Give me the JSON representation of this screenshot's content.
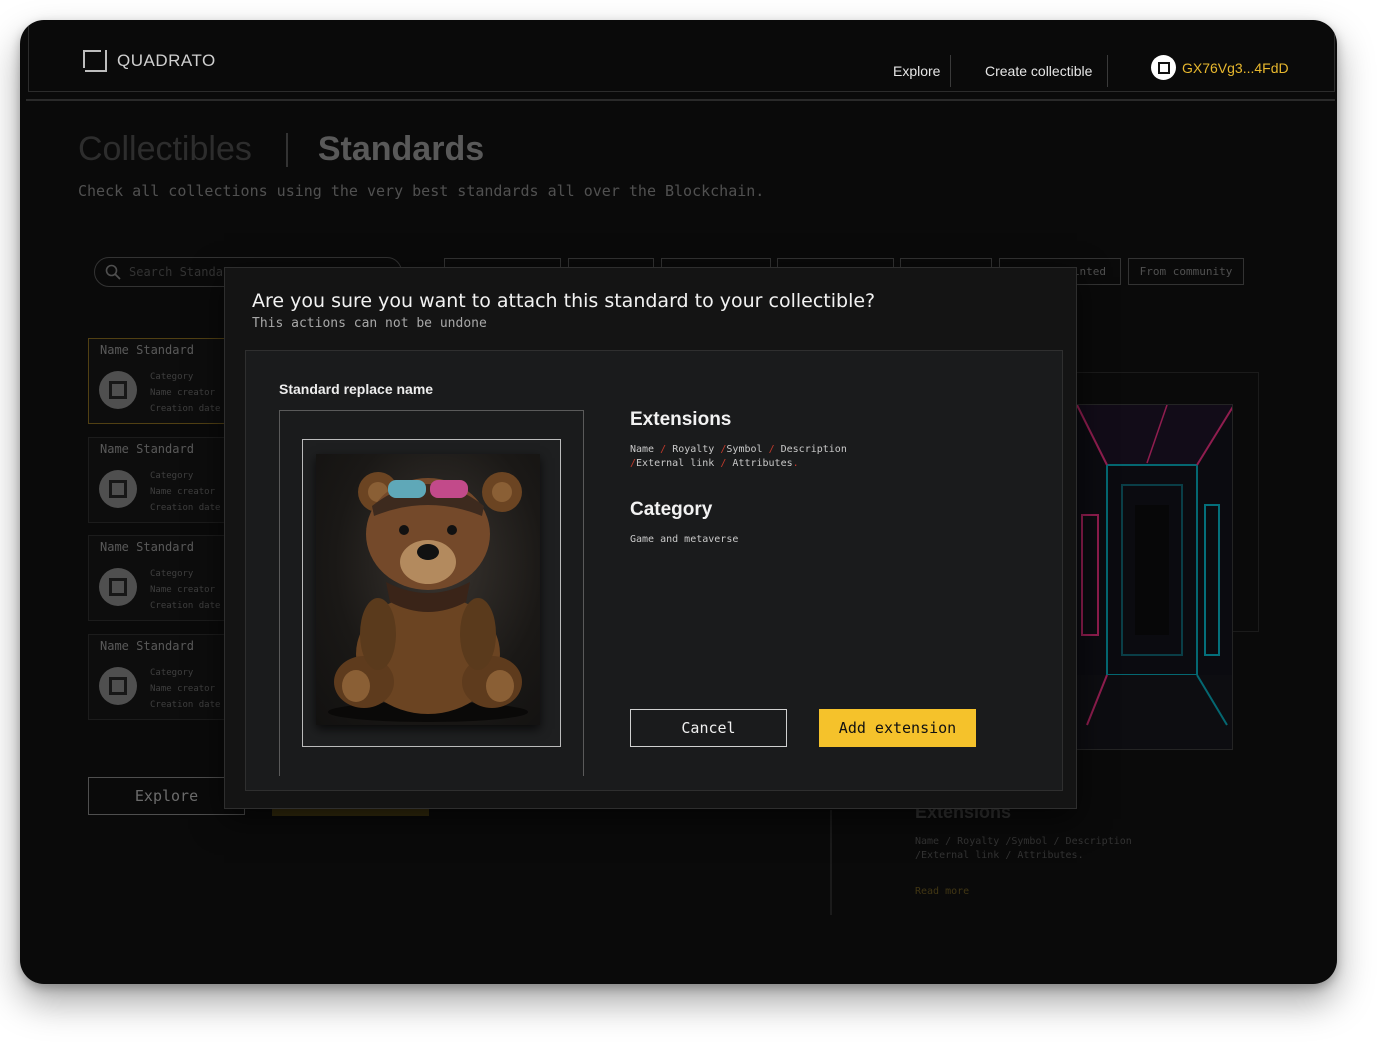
{
  "app": {
    "brand": "QUADRATO"
  },
  "nav": {
    "explore": "Explore",
    "create": "Create collectible",
    "wallet": "GX76Vg3...4FdD"
  },
  "page": {
    "tab_collectibles": "Collectibles",
    "tab_standards": "Standards",
    "subtitle": "Check all collections using the very best standards all over the Blockchain.",
    "search_placeholder": "Search Standa",
    "chips": [
      "",
      "",
      "",
      "",
      "",
      "inted",
      "From community"
    ],
    "cards": [
      {
        "title": "Name Standard",
        "category": "Category",
        "creator": "Name creator",
        "date": "Creation date"
      },
      {
        "title": "Name Standard",
        "category": "Category",
        "creator": "Name creator",
        "date": "Creation date"
      },
      {
        "title": "Name Standard",
        "category": "Category",
        "creator": "Name creator",
        "date": "Creation date"
      },
      {
        "title": "Name Standard",
        "category": "Category",
        "creator": "Name creator",
        "date": "Creation date"
      }
    ],
    "explore_button": "Explore",
    "bg_extensions_title": "Extensions",
    "bg_ext_items": [
      "Name",
      "Royalty",
      "Symbol",
      "Description",
      "External link",
      "Attributes"
    ],
    "read_more": "Read more"
  },
  "modal": {
    "title": "Are you sure you want to attach this standard to your collectible?",
    "subtitle": "This actions can not be undone",
    "standard_name": "Standard replace name",
    "extensions_title": "Extensions",
    "ext_items": [
      "Name",
      "Royalty",
      "Symbol",
      "Description",
      "External link",
      "Attributes"
    ],
    "category_title": "Category",
    "category_value": "Game and metaverse",
    "cancel": "Cancel",
    "add": "Add extension"
  },
  "colors": {
    "accent": "#f5c22b",
    "background": "#0a0a0a",
    "panel": "#141414"
  }
}
